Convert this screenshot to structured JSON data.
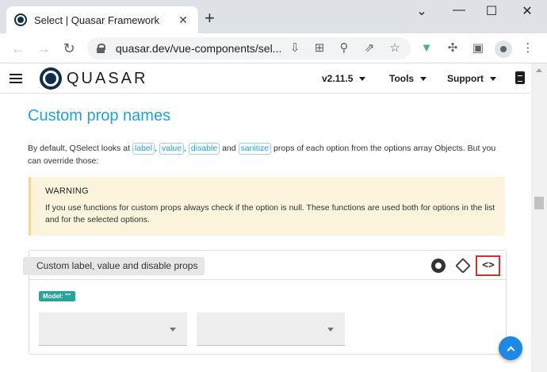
{
  "browser": {
    "tab_title": "Select | Quasar Framework",
    "tab_close": "✕",
    "new_tab": "+",
    "url": "quasar.dev/vue-components/sel..."
  },
  "site": {
    "brand": "QUASAR",
    "nav": [
      {
        "label": "v2.11.5"
      },
      {
        "label": "Tools"
      },
      {
        "label": "Support"
      }
    ]
  },
  "content": {
    "heading": "Custom prop names",
    "intro_before": "By default, QSelect looks at ",
    "chips": [
      "label",
      "value",
      "disable",
      "sanitize"
    ],
    "sep1": ", ",
    "sep2": ", ",
    "sep3": " and ",
    "intro_after": " props of each option from the options array Objects. But you can override those:",
    "warning_title": "WARNING",
    "warning_text": "If you use functions for custom props always check if the option is null. These functions are used both for options in the list and for the selected options."
  },
  "example": {
    "title": "Custom label, value and disable props",
    "model_badge": "Model: \"\"",
    "code_toggle": "<>"
  }
}
